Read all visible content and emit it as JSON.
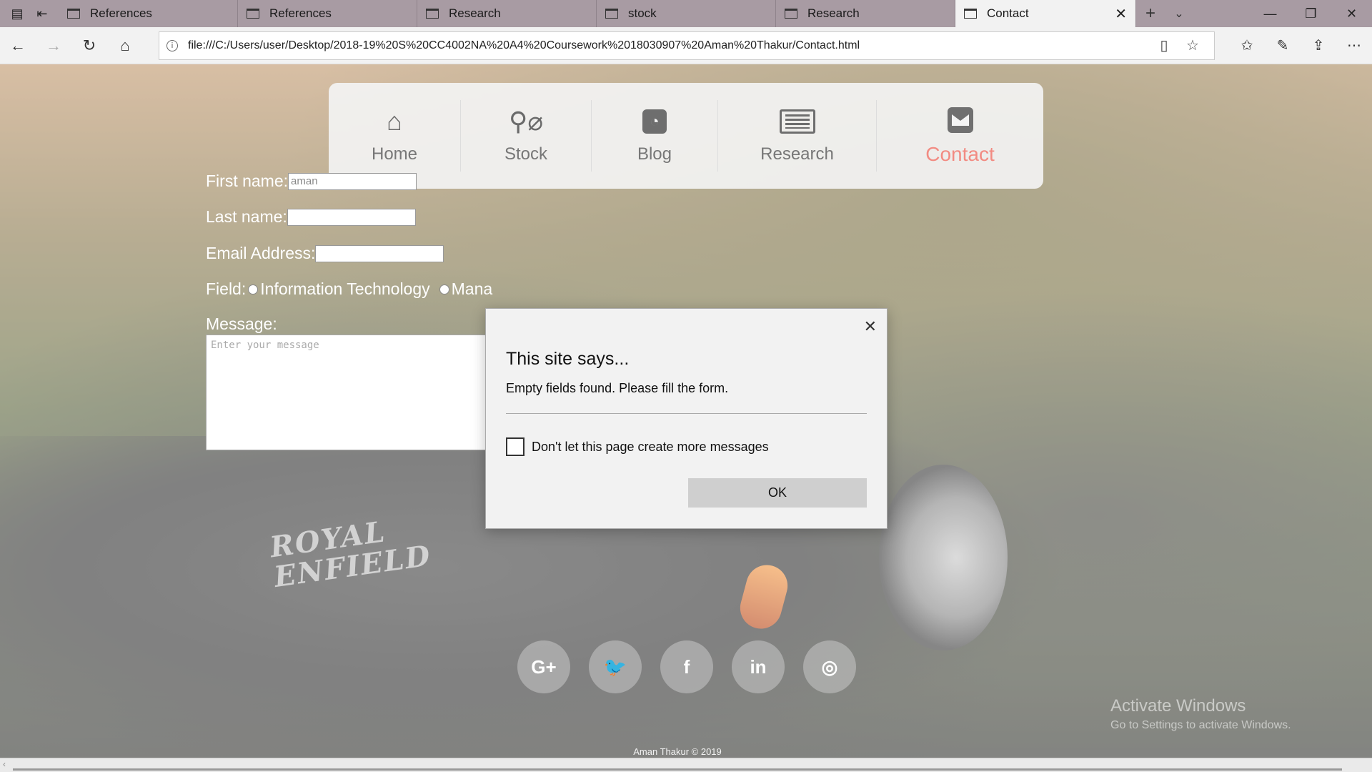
{
  "browser": {
    "tabs": [
      {
        "label": "References"
      },
      {
        "label": "References"
      },
      {
        "label": "Research"
      },
      {
        "label": "stock"
      },
      {
        "label": "Research"
      },
      {
        "label": "Contact",
        "active": true
      }
    ],
    "url": "file:///C:/Users/user/Desktop/2018-19%20S%20CC4002NA%20A4%20Coursework%2018030907%20Aman%20Thakur/Contact.html"
  },
  "nav": {
    "items": [
      {
        "label": "Home",
        "icon": "home-icon"
      },
      {
        "label": "Stock",
        "icon": "motorcycle-icon"
      },
      {
        "label": "Blog",
        "icon": "rss-icon"
      },
      {
        "label": "Research",
        "icon": "newspaper-icon"
      },
      {
        "label": "Contact",
        "icon": "envelope-icon",
        "active": true
      }
    ],
    "active_color": "#f28b82"
  },
  "form": {
    "first_name_label": "First name:",
    "first_name_value": "aman",
    "last_name_label": "Last name:",
    "email_label": "Email Address:",
    "field_label": "Field:",
    "field_option_1": "Information Technology",
    "field_option_2": "Mana",
    "message_label": "Message:",
    "message_placeholder": "Enter your message"
  },
  "background": {
    "brand_line1": "ROYAL",
    "brand_line2": "ENFIELD"
  },
  "social": [
    {
      "icon": "google-plus-icon",
      "glyph": "G+"
    },
    {
      "icon": "twitter-icon",
      "glyph": "🐦"
    },
    {
      "icon": "facebook-icon",
      "glyph": "f"
    },
    {
      "icon": "linkedin-icon",
      "glyph": "in"
    },
    {
      "icon": "instagram-icon",
      "glyph": "◎"
    }
  ],
  "footer": "Aman Thakur © 2019",
  "watermark": {
    "line1": "Activate Windows",
    "line2": "Go to Settings to activate Windows."
  },
  "dialog": {
    "title": "This site says...",
    "message": "Empty fields found. Please fill the form.",
    "checkbox_label": "Don't let this page create more messages",
    "ok_label": "OK"
  }
}
